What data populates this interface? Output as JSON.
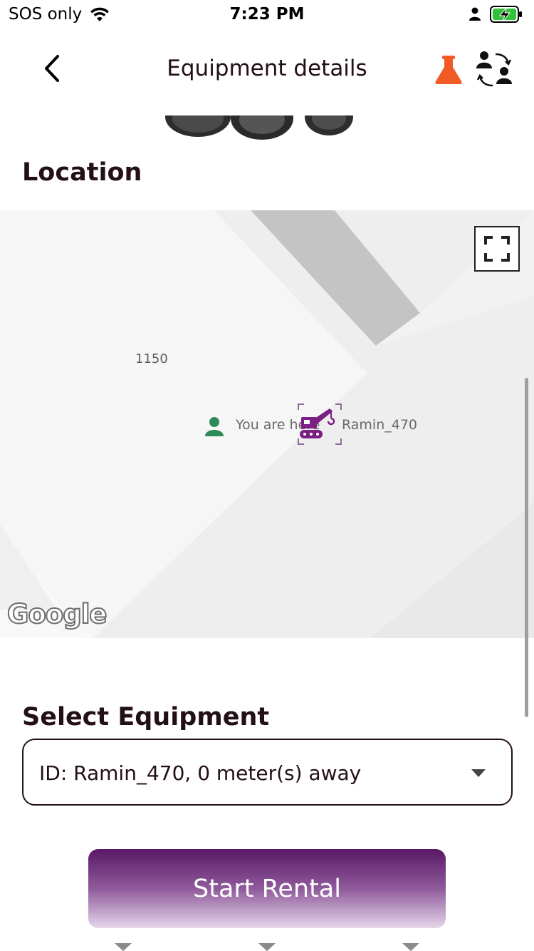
{
  "status_bar": {
    "carrier": "SOS only",
    "time": "7:23 PM"
  },
  "header": {
    "title": "Equipment details",
    "back_icon": "chevron-left-icon",
    "flask_icon": "flask-icon",
    "switch_user_icon": "switch-user-icon"
  },
  "location": {
    "title": "Location",
    "map": {
      "street_number": "1150",
      "user_marker_label": "You are here",
      "equipment_marker_label": "Ramin_470",
      "attribution": "Google",
      "fullscreen_icon": "fullscreen-icon"
    }
  },
  "select_equipment": {
    "title": "Select Equipment",
    "selected_value": "ID: Ramin_470, 0 meter(s) away"
  },
  "actions": {
    "start_rental_label": "Start Rental"
  },
  "colors": {
    "brand_purple": "#5a1866",
    "accent_orange": "#f05a24",
    "text_dark": "#231016",
    "user_marker_green": "#2e8b57",
    "battery_green": "#31c23a"
  }
}
